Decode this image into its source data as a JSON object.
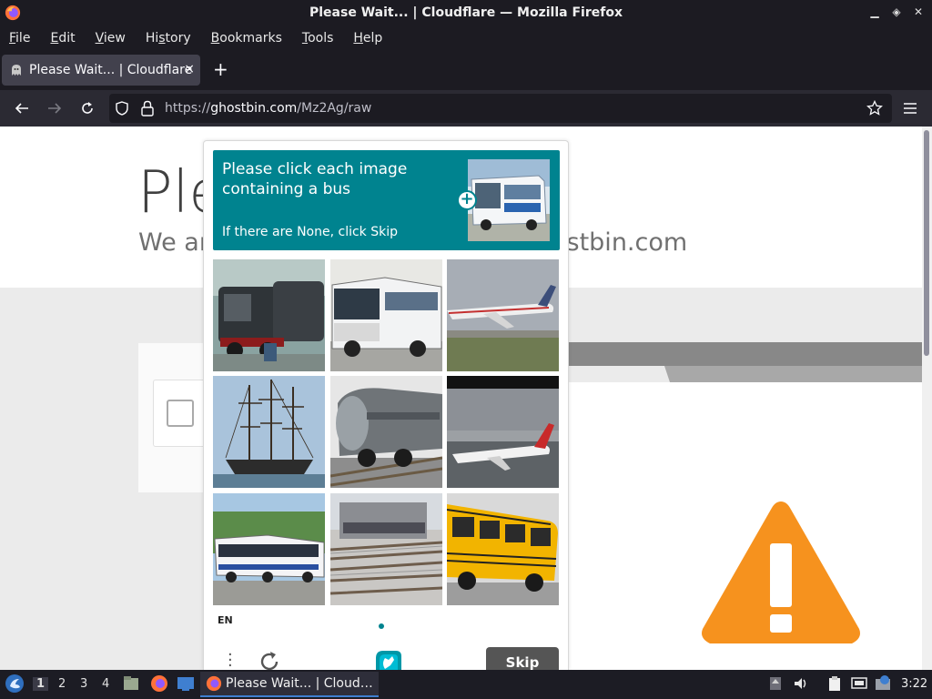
{
  "window": {
    "title": "Please Wait... | Cloudflare — Mozilla Firefox"
  },
  "menu": [
    "File",
    "Edit",
    "View",
    "History",
    "Bookmarks",
    "Tools",
    "Help"
  ],
  "menu_mnemonic": [
    "F",
    "E",
    "V",
    "H",
    "B",
    "T",
    "H"
  ],
  "tabs": [
    {
      "label": "Please Wait... | Cloudflare",
      "close": "×"
    }
  ],
  "newtab": "+",
  "address": {
    "prefix": "https://",
    "host": "ghostbin.com",
    "path": "/Mz2Ag/raw"
  },
  "page": {
    "heading_partial": "Ple",
    "subtitle_left": "We ar",
    "subtitle_right": "ostbin.com"
  },
  "captcha": {
    "prompt": "Please click each image containing a bus",
    "hint": "If there are None, click Skip",
    "sample_icon": "bus-sample-image",
    "images": [
      "steam-locomotives",
      "city-bus",
      "airliner",
      "tall-ship",
      "steam-locomotive-front",
      "airliner-taxiing",
      "articulated-bus",
      "railway-tracks",
      "school-bus"
    ],
    "language": "EN",
    "skip_label": "Skip",
    "accent_color": "#00838f"
  },
  "taskbar": {
    "workspaces": [
      "1",
      "2",
      "3",
      "4"
    ],
    "active_workspace": "1",
    "task_label": "Please Wait... | Cloud…",
    "clock": "3:22"
  }
}
